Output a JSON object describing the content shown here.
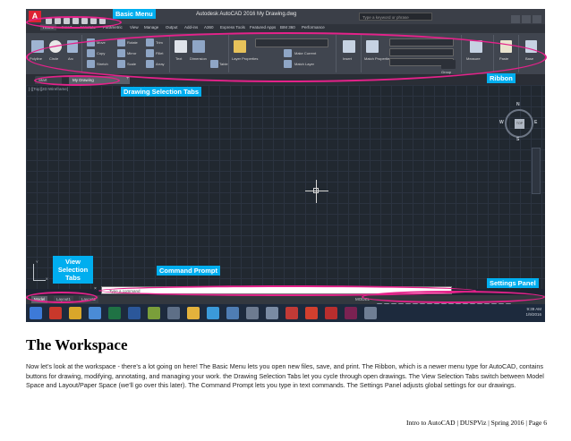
{
  "screenshot": {
    "app_title": "Autodesk AutoCAD 2016    My Drawing.dwg",
    "logo_text": "A",
    "search_placeholder": "Type a keyword or phrase",
    "ribbon_tabs": [
      "Home",
      "Insert",
      "Annotate",
      "Parametric",
      "View",
      "Manage",
      "Output",
      "Add-ins",
      "A360",
      "Express Tools",
      "Featured Apps",
      "BIM 360",
      "Performance"
    ],
    "ribbon_tools": [
      "Polyline",
      "Circle",
      "Arc",
      "Move",
      "Rotate",
      "Trim",
      "Copy",
      "Mirror",
      "Fillet",
      "Stretch",
      "Scale",
      "Array",
      "Text",
      "Dimension",
      "Table",
      "Layer Properties",
      "Make Current",
      "Match Layer",
      "Insert",
      "Match Properties",
      "Group",
      "Measure",
      "Paste",
      "Base"
    ],
    "ribbon_panels": [
      "Draw",
      "Modify",
      "Annotation",
      "Layers",
      "Block",
      "Properties",
      "Groups",
      "Utilities",
      "Clipboard",
      "View"
    ],
    "drawing_tabs": {
      "start": "Start",
      "drawing": "My Drawing"
    },
    "viewport_label": "[-][Top][2D Wireframe]",
    "viewcube": {
      "top": "TOP",
      "n": "N",
      "s": "S",
      "e": "E",
      "w": "W"
    },
    "ucs": {
      "x": "X",
      "y": "Y"
    },
    "command_prompt": "Type a command",
    "view_tabs": [
      "Model",
      "Layout1",
      "Layout2"
    ],
    "status_model": "MODEL",
    "tray": {
      "time": "9:39 AM",
      "date": "1/9/2016"
    }
  },
  "annotations": {
    "basic_menu": "Basic Menu",
    "ribbon": "Ribbon",
    "drawing_tabs": "Drawing Selection Tabs",
    "view_tabs_1": "View",
    "view_tabs_2": "Selection",
    "view_tabs_3": "Tabs",
    "command_prompt": "Command Prompt",
    "settings_panel": "Settings Panel",
    "oval_color": "#e4228a",
    "callout_color": "#00aeef"
  },
  "document": {
    "title": "The Workspace",
    "body": "Now let’s look at the workspace - there’s a lot going on here! The Basic Menu lets you open new files, save, and print. The Ribbon, which is a newer menu type for AutoCAD, contains buttons for drawing, modifying, annotating, and managing your work. the Drawing Selection Tabs let you cycle through open drawings. The View Selection Tabs switch between Model Space and Layout/Paper Space (we’ll go over this later). The Command Prompt lets you type in text commands. The Settings Panel adjusts global settings for our drawings.",
    "footer": "Intro to AutoCAD | DUSPViz | Spring 2016 | Page 6"
  }
}
